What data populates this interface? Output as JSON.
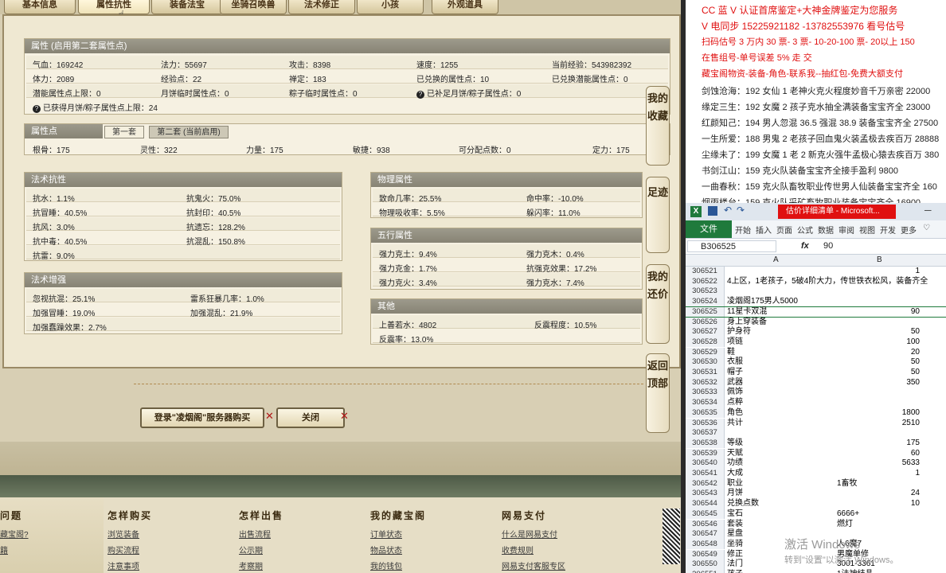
{
  "tabs": [
    "基本信息",
    "属性抗性",
    "装备法宝",
    "坐骑召唤兽",
    "法术修正",
    "小孩",
    "外观道具"
  ],
  "attr": {
    "header": "属性 (启用第二套属性点)",
    "rows": [
      [
        "气血：169242",
        "法力：55697",
        "攻击：8398",
        "速度：1255",
        "当前经验：543982392"
      ],
      [
        "体力：2089",
        "经验点：22",
        "禅定：183",
        "已兑换的属性点：10",
        "已兑换潜能属性点：0"
      ],
      [
        "潜能属性点上限：0",
        "月饼临时属性点：0",
        "粽子临时属性点：0",
        "已补足月饼/粽子属性点：0",
        ""
      ]
    ],
    "note": "已获得月饼/粽子属性点上限：24"
  },
  "points": {
    "header": "属性点",
    "tab1": "第一套",
    "tab2": "第二套 (当前启用)",
    "values": [
      "根骨：175",
      "灵性：322",
      "力量：175",
      "敏捷：938",
      "可分配点数：0",
      "定力：175"
    ]
  },
  "resist": {
    "header": "法术抗性",
    "items": [
      [
        "抗水：1.1%",
        "抗鬼火：75.0%"
      ],
      [
        "抗冒睡：40.5%",
        "抗封印：40.5%"
      ],
      [
        "抗风：3.0%",
        "抗遗忘：128.2%"
      ],
      [
        "抗中毒：40.5%",
        "抗混乱：150.8%"
      ],
      [
        "抗雷：9.0%",
        ""
      ]
    ]
  },
  "boost": {
    "header": "法术增强",
    "items": [
      [
        "忽视抗混：25.1%",
        "雷系狂暴几率：1.0%"
      ],
      [
        "加强冒睡：19.0%",
        "加强混乱：21.9%"
      ],
      [
        "加强蠢躁效果：2.7%",
        ""
      ]
    ]
  },
  "physical": {
    "header": "物理属性",
    "items": [
      [
        "致命几率：25.5%",
        "命中率：-10.0%"
      ],
      [
        "物理吸收率：5.5%",
        "躲闪率：11.0%"
      ]
    ]
  },
  "wuxing": {
    "header": "五行属性",
    "items": [
      [
        "强力克土：9.4%",
        "强力克木：0.4%"
      ],
      [
        "强力克金：1.7%",
        "抗强克效果：17.2%"
      ],
      [
        "强力克火：3.4%",
        "强力克水：7.4%"
      ]
    ]
  },
  "other": {
    "header": "其他",
    "items": [
      [
        "上善若水：4802",
        "反震程度：10.5%"
      ],
      [
        "反震率：13.0%",
        ""
      ]
    ]
  },
  "side": [
    "我的收藏",
    "足迹",
    "我的还价",
    "返回顶部"
  ],
  "buttons": {
    "buy": "登录\"凌烟阁\"服务器购买",
    "close": "关闭"
  },
  "footer": {
    "cols": [
      {
        "h": "问题",
        "links": [
          "藏宝阁?",
          "籍"
        ]
      },
      {
        "h": "怎样购买",
        "links": [
          "浏览装备",
          "购买流程",
          "注意事项"
        ]
      },
      {
        "h": "怎样出售",
        "links": [
          "出售流程",
          "公示期",
          "考察期"
        ]
      },
      {
        "h": "我的藏宝阁",
        "links": [
          "订单状态",
          "物品状态",
          "我的钱包"
        ]
      },
      {
        "h": "网易支付",
        "links": [
          "什么是网易支付",
          "收费规则",
          "网易支付客服专区"
        ]
      }
    ]
  },
  "notes": [
    {
      "t": "CC 蓝 V 认证首席鉴定+大神金牌鉴定为您服务",
      "c": "#e01010"
    },
    {
      "t": "V 电同步 15225921182 -13782553976 看号估号",
      "c": "#e01010"
    },
    {
      "t": "扫码估号 3 万内 30 票- 3     票- 10-20-100 票- 20以上 150",
      "c": "#e01010"
    },
    {
      "t": "在售组号-单号误差 5%                  走                  交",
      "c": "#e01010"
    },
    {
      "t": "藏宝阁物资-装备-角色-联系我--抽红包-免费大额支付",
      "c": "#e01010"
    },
    {
      "t": "剑蚀沧海：192 女仙 1 老神火克火程度妙音千万亲密 22000",
      "c": "#222"
    },
    {
      "t": "缘定三生：192 女魔 2 孩子克水抽全满装备宝宝齐全 23000",
      "c": "#222"
    },
    {
      "t": "红颜知己：194 男人忽混 36.5 强混 38.9 装备宝宝齐全 27500",
      "c": "#222"
    },
    {
      "t": "一生所爱：188 男鬼 2 老孩子回血鬼火装孟极去疾百万 28888",
      "c": "#222"
    },
    {
      "t": "尘缘未了：199 女魔 1 老 2 新克火强牛孟极心猿去疾百万 380",
      "c": "#222"
    },
    {
      "t": "书剑江山：159 克火队装备宝宝齐全接手盈利 9800",
      "c": "#222"
    },
    {
      "t": "一曲春秋：159 克火队畜牧职业传世男人仙装备宝宝齐全 160",
      "c": "#222"
    },
    {
      "t": "烟雨楼台：159 克火队采矿畜牧职业装备宝宝齐全 16900",
      "c": "#222"
    }
  ],
  "excel": {
    "title": "估价详细清单 - Microsoft...",
    "ribbon": [
      "文件",
      "开始",
      "插入",
      "页面",
      "公式",
      "数据",
      "审阅",
      "视图",
      "开发",
      "更多"
    ],
    "namebox": "B306525",
    "formula": "90",
    "cols": [
      "A",
      "B"
    ],
    "rows": [
      [
        "306521",
        "",
        "1"
      ],
      [
        "306522",
        "4上区，1老孩子，5破4阶大力，传世铁衣松风，装备齐全",
        ""
      ],
      [
        "306523",
        "",
        ""
      ],
      [
        "306524",
        "凌烟阁175男人5000",
        ""
      ],
      [
        "306525",
        "11星卡双混",
        "90"
      ],
      [
        "306526",
        "身上穿装备",
        ""
      ],
      [
        "306527",
        "护身符",
        "50"
      ],
      [
        "306528",
        "项链",
        "100"
      ],
      [
        "306529",
        "鞋",
        "20"
      ],
      [
        "306530",
        "衣服",
        "50"
      ],
      [
        "306531",
        "帽子",
        "50"
      ],
      [
        "306532",
        "武器",
        "350"
      ],
      [
        "306533",
        "佩饰",
        ""
      ],
      [
        "306534",
        "点粹",
        ""
      ],
      [
        "306535",
        "角色",
        "1800"
      ],
      [
        "306536",
        "共计",
        "2510"
      ],
      [
        "306537",
        "",
        ""
      ],
      [
        "306538",
        "等级",
        "175"
      ],
      [
        "306539",
        "天赋",
        "60"
      ],
      [
        "306540",
        "功绩",
        "5633"
      ],
      [
        "306541",
        "大成",
        "1"
      ],
      [
        "306542",
        "职业",
        "1畜牧"
      ],
      [
        "306543",
        "月饼",
        "24"
      ],
      [
        "306544",
        "兑换点数",
        "10"
      ],
      [
        "306545",
        "宝石",
        "6666+"
      ],
      [
        "306546",
        "套装",
        "燃灯"
      ],
      [
        "306547",
        "星盘",
        ""
      ],
      [
        "306548",
        "坐骑",
        "人6魔7"
      ],
      [
        "306549",
        "修正",
        "男魔单修"
      ],
      [
        "306550",
        "法门",
        "3001-3361"
      ],
      [
        "306551",
        "孩子",
        "1法神结晶"
      ]
    ]
  },
  "watermark": {
    "line1": "激活 Windows",
    "line2": "转到\"设置\"以激活 Windows。"
  }
}
